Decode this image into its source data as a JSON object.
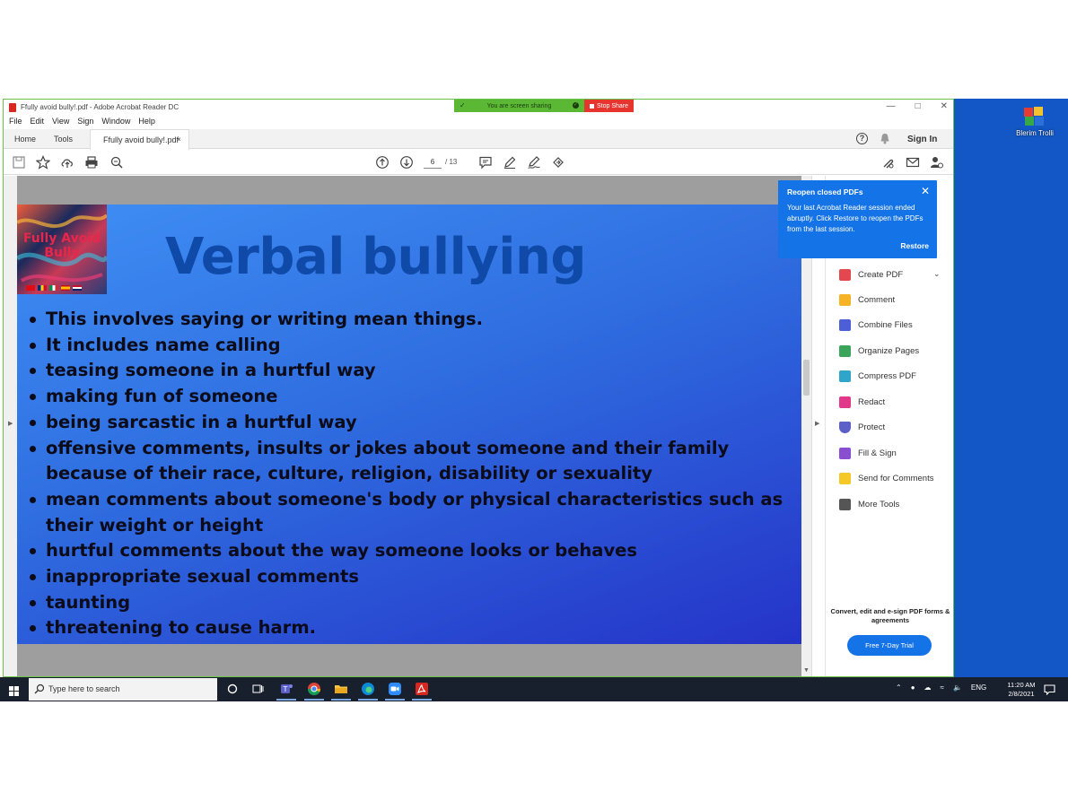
{
  "window": {
    "title": "Ffully avoid bully!.pdf - Adobe Acrobat Reader DC",
    "controls": [
      "—",
      "□",
      "✕"
    ]
  },
  "screen_share": {
    "status": "You are screen sharing",
    "stop_label": "Stop Share"
  },
  "menu": [
    "File",
    "Edit",
    "View",
    "Sign",
    "Window",
    "Help"
  ],
  "tabs": {
    "home": "Home",
    "tools": "Tools",
    "document": "Ffully avoid bully!.pdf",
    "close": "×"
  },
  "header": {
    "sign_in": "Sign In",
    "help": "?"
  },
  "toolbar": {
    "page_current": "6",
    "page_total": "/ 13"
  },
  "slide": {
    "logo_text": "Fully Avoid Bully",
    "title": "Verbal bullying",
    "bullets": [
      "This involves saying or writing mean things.",
      "It includes name calling",
      "teasing someone in a hurtful way",
      "making fun of someone",
      "being sarcastic in a hurtful way",
      "offensive comments, insults or jokes about someone and their family because of their race, culture, religion, disability or sexuality",
      "mean comments about someone's body or physical characteristics such as their weight or height",
      "hurtful comments about the way someone looks or behaves",
      "inappropriate sexual comments",
      "taunting",
      "threatening to cause harm."
    ]
  },
  "popup": {
    "title": "Reopen closed PDFs",
    "body": "Your last Acrobat Reader session ended abruptly. Click Restore to reopen the PDFs from the last session.",
    "restore": "Restore",
    "close": "✕"
  },
  "tools_pane": {
    "items": [
      {
        "label": "Create PDF",
        "color": "#e34850"
      },
      {
        "label": "Comment",
        "color": "#f5b325"
      },
      {
        "label": "Combine Files",
        "color": "#4d5fd6"
      },
      {
        "label": "Organize Pages",
        "color": "#3ba55c"
      },
      {
        "label": "Compress PDF",
        "color": "#2fa5c9"
      },
      {
        "label": "Redact",
        "color": "#e2388a"
      },
      {
        "label": "Protect",
        "color": "#5b5fc7"
      },
      {
        "label": "Fill & Sign",
        "color": "#8a4fd0"
      },
      {
        "label": "Send for Comments",
        "color": "#f5c825"
      },
      {
        "label": "More Tools",
        "color": "#555555"
      }
    ],
    "promo": "Convert, edit and e-sign PDF forms & agreements",
    "trial_button": "Free 7-Day Trial"
  },
  "desktop": {
    "icon_label": "Blerim Trolli"
  },
  "taskbar": {
    "search_placeholder": "Type here to search",
    "language": "ENG",
    "time": "11:20 AM",
    "date": "2/8/2021"
  }
}
